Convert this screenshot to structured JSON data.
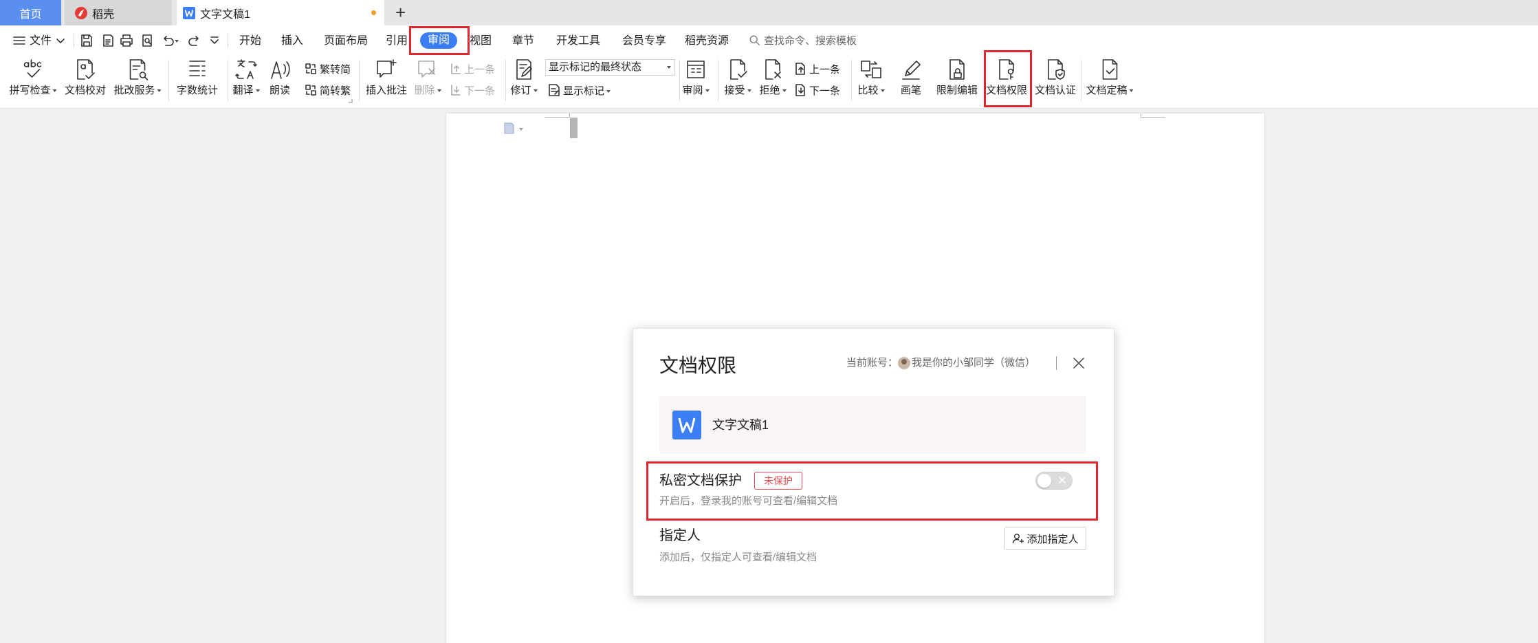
{
  "window_tabs": [
    {
      "label": "首页"
    },
    {
      "label": "稻壳"
    },
    {
      "label": "文字文稿1"
    }
  ],
  "menu": {
    "file_label": "文件",
    "tabs": [
      "开始",
      "插入",
      "页面布局",
      "引用",
      "审阅",
      "视图",
      "章节",
      "开发工具",
      "会员专享",
      "稻壳资源"
    ],
    "active_tab_index": 4,
    "search_placeholder": "查找命令、搜索模板"
  },
  "toolbar": {
    "spell_check": "拼写检查",
    "doc_proofread": "文档校对",
    "grading_service": "批改服务",
    "word_count": "字数统计",
    "translate": "翻译",
    "read_aloud": "朗读",
    "trad_to_simp": "繁转简",
    "simp_to_trad": "简转繁",
    "insert_comment": "插入批注",
    "delete_comment": "删除",
    "comment_prev": "上一条",
    "comment_next": "下一条",
    "track_changes": "修订",
    "markup_mode": "显示标记的最终状态",
    "show_markup": "显示标记",
    "review_pane": "审阅",
    "accept": "接受",
    "reject": "拒绝",
    "change_prev": "上一条",
    "change_next": "下一条",
    "compare": "比较",
    "pen": "画笔",
    "restrict_editing": "限制编辑",
    "doc_permission": "文档权限",
    "doc_certify": "文档认证",
    "doc_finalize": "文档定稿"
  },
  "dialog": {
    "title": "文档权限",
    "account_label": "当前账号：",
    "account_name": "我是你的小邹同学（微信）",
    "file_name": "文字文稿1",
    "private_title": "私密文档保护",
    "private_badge": "未保护",
    "private_enabled": false,
    "private_desc": "开启后，登录我的账号可查看/编辑文档",
    "assignee_title": "指定人",
    "assignee_desc": "添加后，仅指定人可查看/编辑文档",
    "add_assignee_button": "添加指定人"
  },
  "colors": {
    "accent": "#3c7ff5",
    "highlight_box": "#e0262d",
    "badge_red": "#e5484d",
    "home_tab": "#5a8ef0",
    "unsaved_dot": "#f0a020"
  }
}
